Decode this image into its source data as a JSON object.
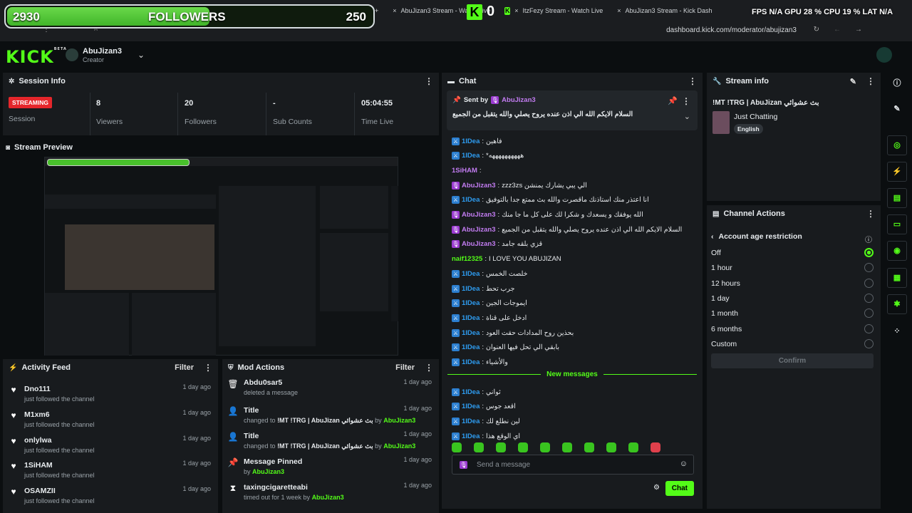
{
  "overlay": {
    "followers_left": "2930",
    "followers_label": "FOLLOWERS",
    "followers_right": "250",
    "followers_progress": 0.55,
    "kick_count": "0",
    "stats": "FPS N/A   GPU 28 %   CPU 19 %   LAT N/A"
  },
  "browser": {
    "tab_new": "+",
    "tab1": "AbuJizan3 Stream - Watch Live",
    "tab2": "ItzFezy Stream - Watch Live",
    "tab3": "AbuJizan3 Stream - Kick Dash",
    "url": "dashboard.kick.com/moderator/abujizan3"
  },
  "header": {
    "logo": "KICK",
    "logo_tag": "BETA",
    "username": "AbuJizan3",
    "role": "Creator"
  },
  "session": {
    "title": "Session Info",
    "status": "STREAMING",
    "status_label": "Session",
    "cells": [
      {
        "value": "8",
        "label": "Viewers"
      },
      {
        "value": "20",
        "label": "Followers"
      },
      {
        "value": "-",
        "label": "Sub Counts"
      },
      {
        "value": "05:04:55",
        "label": "Time Live"
      }
    ]
  },
  "preview": {
    "title": "Stream Preview"
  },
  "activity": {
    "title": "Activity Feed",
    "filter": "Filter",
    "rows": [
      {
        "name": "Dno111",
        "sub": "just followed the channel",
        "time": "1 day ago"
      },
      {
        "name": "M1xm6",
        "sub": "just followed the channel",
        "time": "1 day ago"
      },
      {
        "name": "onlylwa",
        "sub": "just followed the channel",
        "time": "1 day ago"
      },
      {
        "name": "1SiHAM",
        "sub": "just followed the channel",
        "time": "1 day ago"
      },
      {
        "name": "OSAMZII",
        "sub": "just followed the channel",
        "time": "1 day ago"
      }
    ]
  },
  "modactions": {
    "title": "Mod Actions",
    "filter": "Filter",
    "rows": [
      {
        "name": "Abdu0sar5",
        "sub": "deleted a message",
        "time": "1 day ago"
      },
      {
        "name": "Title",
        "sub_prefix": "changed to",
        "sub_title": "!MT !TRG | AbuJizan بث عشوائي",
        "by": "by",
        "actor": "AbuJizan3",
        "time": "1 day ago"
      },
      {
        "name": "Title",
        "sub_prefix": "changed to",
        "sub_title": "!MT !TRG | AbuJizan بث عشوائي",
        "by": "by",
        "actor": "AbuJizan3",
        "time": "1 day ago"
      },
      {
        "name": "Message Pinned",
        "sub_prefix": "by",
        "actor": "AbuJizan3",
        "time": "1 day ago"
      },
      {
        "name": "taxingcigaretteabi",
        "sub_prefix": "timed out for 1 week by",
        "actor": "AbuJizan3",
        "time": "1 day ago"
      }
    ]
  },
  "chat": {
    "title": "Chat",
    "pinned_sent_by": "Sent by",
    "pinned_user": "AbuJizan3",
    "pinned_text": "السلام الايكم الله الي اذن عنده يروح يصلي والله يتقبل من الجميع",
    "messages": [
      {
        "user": "1IDea",
        "type": "mod",
        "text": "فاهين"
      },
      {
        "user": "1IDea",
        "type": "mod",
        "text": "*ههههههههههه"
      },
      {
        "user": "1SiHAM",
        "type": "plain",
        "text": ""
      },
      {
        "user": "AbuJizan3",
        "type": "broadcaster",
        "text": "zzz3zs الي يبي يشارك يمنشن"
      },
      {
        "user": "1IDea",
        "type": "mod",
        "text": "انا اعتذر منك استاذنك ماقصرت والله بث ممتع جدا بالتوفيق"
      },
      {
        "user": "AbuJizan3",
        "type": "broadcaster",
        "text": "الله يوفقك و يسعدك و شكرا لك على كل ما جا منك"
      },
      {
        "user": "AbuJizan3",
        "type": "broadcaster",
        "text": "السلام الايكم الله الي اذن عنده يروح يصلي والله يتقبل من الجميع"
      },
      {
        "user": "AbuJizan3",
        "type": "broadcaster",
        "text": "قزي بلقه جامد"
      },
      {
        "user": "naif12325",
        "type": "plain",
        "text": "I LOVE YOU ABUJIZAN"
      },
      {
        "user": "1IDea",
        "type": "mod",
        "text": "خلصت الخمس"
      },
      {
        "user": "1IDea",
        "type": "mod",
        "text": "جرب تحط"
      },
      {
        "user": "1IDea",
        "type": "mod",
        "text": "ايموجات الجين"
      },
      {
        "user": "1IDea",
        "type": "mod",
        "text": "ادخل على قناة"
      },
      {
        "user": "1IDea",
        "type": "mod",
        "text": "بحذين روح المدادات حقت العود"
      },
      {
        "user": "1IDea",
        "type": "mod",
        "text": "بابقي الي تحل فيها العنوان"
      },
      {
        "user": "1IDea",
        "type": "mod",
        "text": "والأشياء"
      }
    ],
    "new_messages": "New messages",
    "new": [
      {
        "user": "1IDea",
        "type": "mod",
        "text": "ثواني"
      },
      {
        "user": "1IDea",
        "type": "mod",
        "text": "اقعد جوس"
      },
      {
        "user": "1IDea",
        "type": "mod",
        "text": "لين نطلع لك"
      },
      {
        "user": "1IDea",
        "type": "mod",
        "text": "اي الوقع هذا"
      }
    ],
    "input_placeholder": "Send a message",
    "send_label": "Chat"
  },
  "streaminfo": {
    "title": "Stream info",
    "stream_title": "!MT !TRG | AbuJizan بث عشوائي",
    "category": "Just Chatting",
    "language": "English"
  },
  "channelactions": {
    "title": "Channel Actions",
    "sub_title": "Account age restriction",
    "options": [
      "Off",
      "1 hour",
      "12 hours",
      "1 day",
      "1 month",
      "6 months",
      "Custom"
    ],
    "selected": "Off",
    "confirm": "Confirm"
  },
  "colors": {
    "accent": "#53fc18",
    "live": "#e5262b",
    "panel": "#181b1e",
    "mod": "#2c7fd0",
    "broadcaster": "#9b3bd1"
  }
}
